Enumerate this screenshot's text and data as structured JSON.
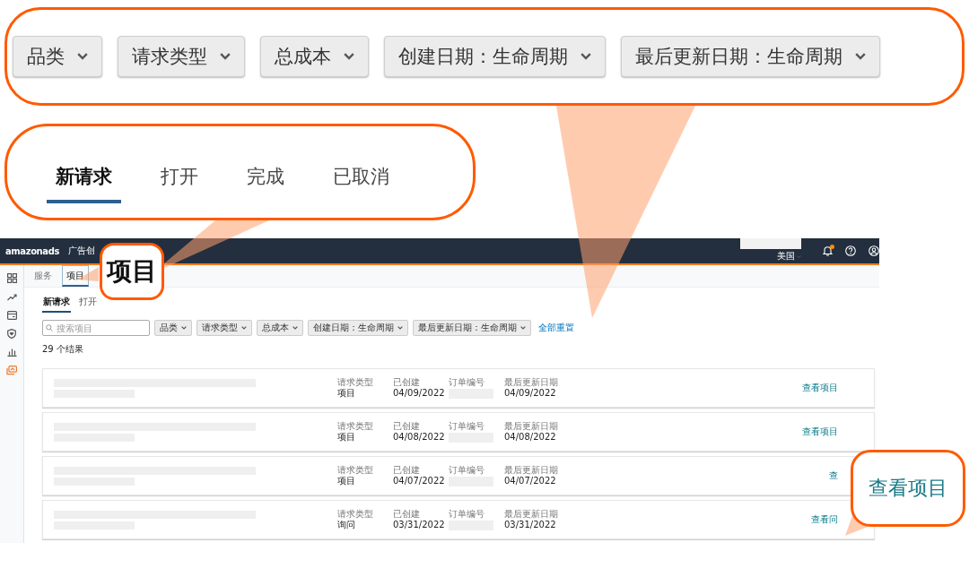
{
  "callouts": {
    "filters": [
      "品类",
      "请求类型",
      "总成本",
      "创建日期：生命周期",
      "最后更新日期：生命周期"
    ],
    "tabs": [
      {
        "label": "新请求",
        "selected": true
      },
      {
        "label": "打开",
        "selected": false
      },
      {
        "label": "完成",
        "selected": false
      },
      {
        "label": "已取消",
        "selected": false
      }
    ],
    "zoom_label": "项目",
    "action_label": "查看项目"
  },
  "app": {
    "logo": "amazonads",
    "nav_title": "广告创",
    "region": "美国",
    "notification": true,
    "sidebar": [
      {
        "selected": false
      },
      {
        "selected": false
      },
      {
        "selected": false
      },
      {
        "selected": false
      },
      {
        "selected": false
      },
      {
        "selected": true
      }
    ],
    "subtabs": [
      {
        "label": "服务",
        "selected": false
      },
      {
        "label": "项目",
        "selected": true
      }
    ],
    "tabs": [
      {
        "label": "新请求",
        "selected": true
      },
      {
        "label": "打开",
        "selected": false
      }
    ],
    "search": {
      "placeholder": "搜索项目"
    },
    "filters": [
      "品类",
      "请求类型",
      "总成本",
      "创建日期：生命周期",
      "最后更新日期：生命周期"
    ],
    "reset_link": "全部重置",
    "results_count": "29 个结果",
    "rows": [
      {
        "type_label": "请求类型",
        "type": "项目",
        "created_label": "已创建",
        "created": "04/09/2022",
        "order_label": "订单编号",
        "updated_label": "最后更新日期",
        "updated": "04/09/2022",
        "action": "查看项目"
      },
      {
        "type_label": "请求类型",
        "type": "项目",
        "created_label": "已创建",
        "created": "04/08/2022",
        "order_label": "订单编号",
        "updated_label": "最后更新日期",
        "updated": "04/08/2022",
        "action": "查看项目"
      },
      {
        "type_label": "请求类型",
        "type": "项目",
        "created_label": "已创建",
        "created": "04/07/2022",
        "order_label": "订单编号",
        "updated_label": "最后更新日期",
        "updated": "04/07/2022",
        "action": "查"
      },
      {
        "type_label": "请求类型",
        "type": "询问",
        "created_label": "已创建",
        "created": "03/31/2022",
        "order_label": "订单编号",
        "updated_label": "最后更新日期",
        "updated": "03/31/2022",
        "action": "查看问"
      }
    ]
  }
}
